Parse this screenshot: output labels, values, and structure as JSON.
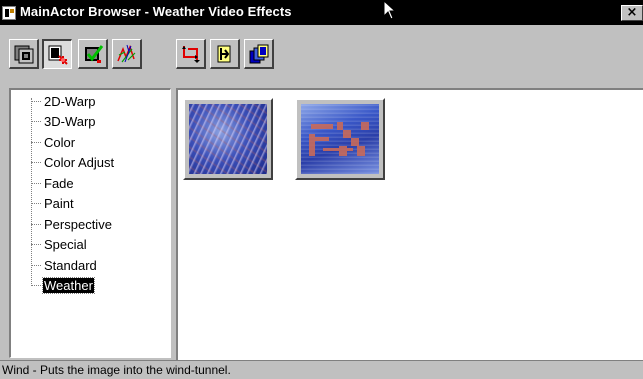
{
  "window": {
    "title": "MainActor Browser - Weather Video Effects",
    "close_glyph": "×"
  },
  "toolbar": {
    "buttons": [
      {
        "name": "browse-media-button",
        "icon": "film-frames-icon",
        "pressed": false
      },
      {
        "name": "video-effects-button",
        "icon": "effect-frame-icon",
        "pressed": true
      },
      {
        "name": "apply-effect-button",
        "icon": "checkmark-frame-icon",
        "pressed": false
      },
      {
        "name": "particles-effect-button",
        "icon": "sparkle-effect-icon",
        "pressed": false
      },
      {
        "name": "transition-button",
        "icon": "arrows-transition-icon",
        "pressed": false
      },
      {
        "name": "import-button",
        "icon": "import-arrow-icon",
        "pressed": false
      },
      {
        "name": "copy-clips-button",
        "icon": "stacked-frames-icon",
        "pressed": false
      }
    ]
  },
  "tree": {
    "items": [
      {
        "label": "2D-Warp",
        "selected": false
      },
      {
        "label": "3D-Warp",
        "selected": false
      },
      {
        "label": "Color",
        "selected": false
      },
      {
        "label": "Color Adjust",
        "selected": false
      },
      {
        "label": "Fade",
        "selected": false
      },
      {
        "label": "Paint",
        "selected": false
      },
      {
        "label": "Perspective",
        "selected": false
      },
      {
        "label": "Special",
        "selected": false
      },
      {
        "label": "Standard",
        "selected": false
      },
      {
        "label": "Weather",
        "selected": true
      }
    ]
  },
  "effects": [
    {
      "name": "wind-effect-thumbnail",
      "image": "rain-texture"
    },
    {
      "name": "fx-effect-thumbnail",
      "image": "fx-wave-texture"
    }
  ],
  "status": {
    "text": "Wind - Puts the image into the wind-tunnel."
  },
  "colors": {
    "title_bg": "#000000",
    "face": "#c0c0c0",
    "selection_bg": "#000000",
    "effect_blue": "#3a58c8"
  }
}
